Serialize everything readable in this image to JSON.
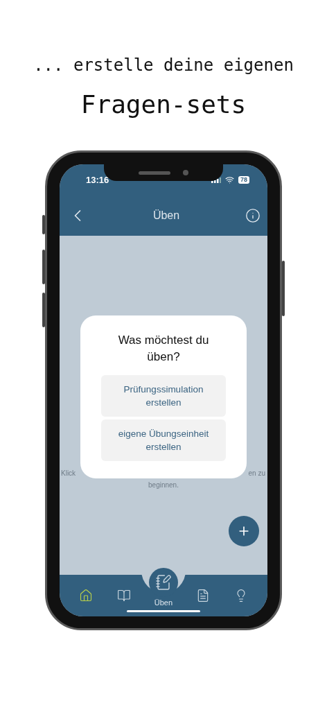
{
  "headline": {
    "line_1": "... erstelle deine eigenen",
    "line_2": "Fragen-sets"
  },
  "status_bar": {
    "time": "13:16",
    "battery": "78"
  },
  "header": {
    "title": "Üben"
  },
  "background_hint": {
    "left": "Klick",
    "right": "en zu",
    "line_2": "beginnen."
  },
  "dialog": {
    "title": "Was möchtest du üben?",
    "options": [
      "Prüfungssimulation erstellen",
      "eigene Übungseinheit erstellen"
    ]
  },
  "tab_bar": [
    {
      "kind": "home",
      "selected": false
    },
    {
      "kind": "book",
      "selected": false
    },
    {
      "kind": "practice",
      "label": "Üben",
      "selected": true
    },
    {
      "kind": "document",
      "selected": false
    },
    {
      "kind": "idea",
      "selected": false
    }
  ]
}
